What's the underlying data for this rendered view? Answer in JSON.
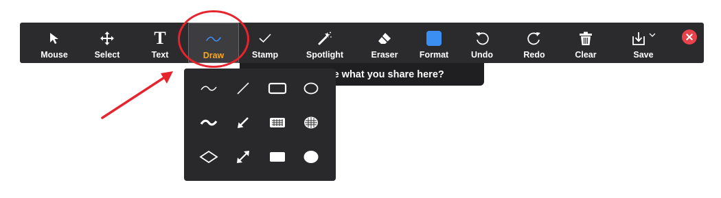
{
  "toolbar": {
    "tools": [
      {
        "label": "Mouse",
        "icon": "mouse-pointer-icon"
      },
      {
        "label": "Select",
        "icon": "move-icon"
      },
      {
        "label": "Text",
        "icon": "text-icon"
      },
      {
        "label": "Draw",
        "icon": "draw-squiggle-icon",
        "active": true
      },
      {
        "label": "Stamp",
        "icon": "checkmark-icon"
      },
      {
        "label": "Spotlight",
        "icon": "magic-wand-icon"
      },
      {
        "label": "Eraser",
        "icon": "eraser-icon"
      },
      {
        "label": "Format",
        "icon": "color-swatch-icon"
      },
      {
        "label": "Undo",
        "icon": "undo-icon"
      },
      {
        "label": "Redo",
        "icon": "redo-icon"
      },
      {
        "label": "Clear",
        "icon": "trash-icon"
      },
      {
        "label": "Save",
        "icon": "save-download-icon"
      }
    ],
    "active_color": "#f5a623",
    "format_color": "#3b8ef2"
  },
  "tooltip": {
    "text": "Who can see what you share here?",
    "icon": "person-icon"
  },
  "draw_panel": {
    "shapes": [
      "thin-squiggle-icon",
      "thin-line-icon",
      "rectangle-outline-icon",
      "ellipse-outline-icon",
      "thick-squiggle-icon",
      "arrow-icon",
      "rectangle-semi-filled-icon",
      "ellipse-semi-filled-icon",
      "diamond-outline-icon",
      "double-arrow-icon",
      "rectangle-filled-icon",
      "ellipse-filled-icon"
    ]
  },
  "annotation": {
    "color": "#e5242d"
  },
  "close_button": {
    "icon": "close-icon",
    "color": "#e8424a"
  }
}
